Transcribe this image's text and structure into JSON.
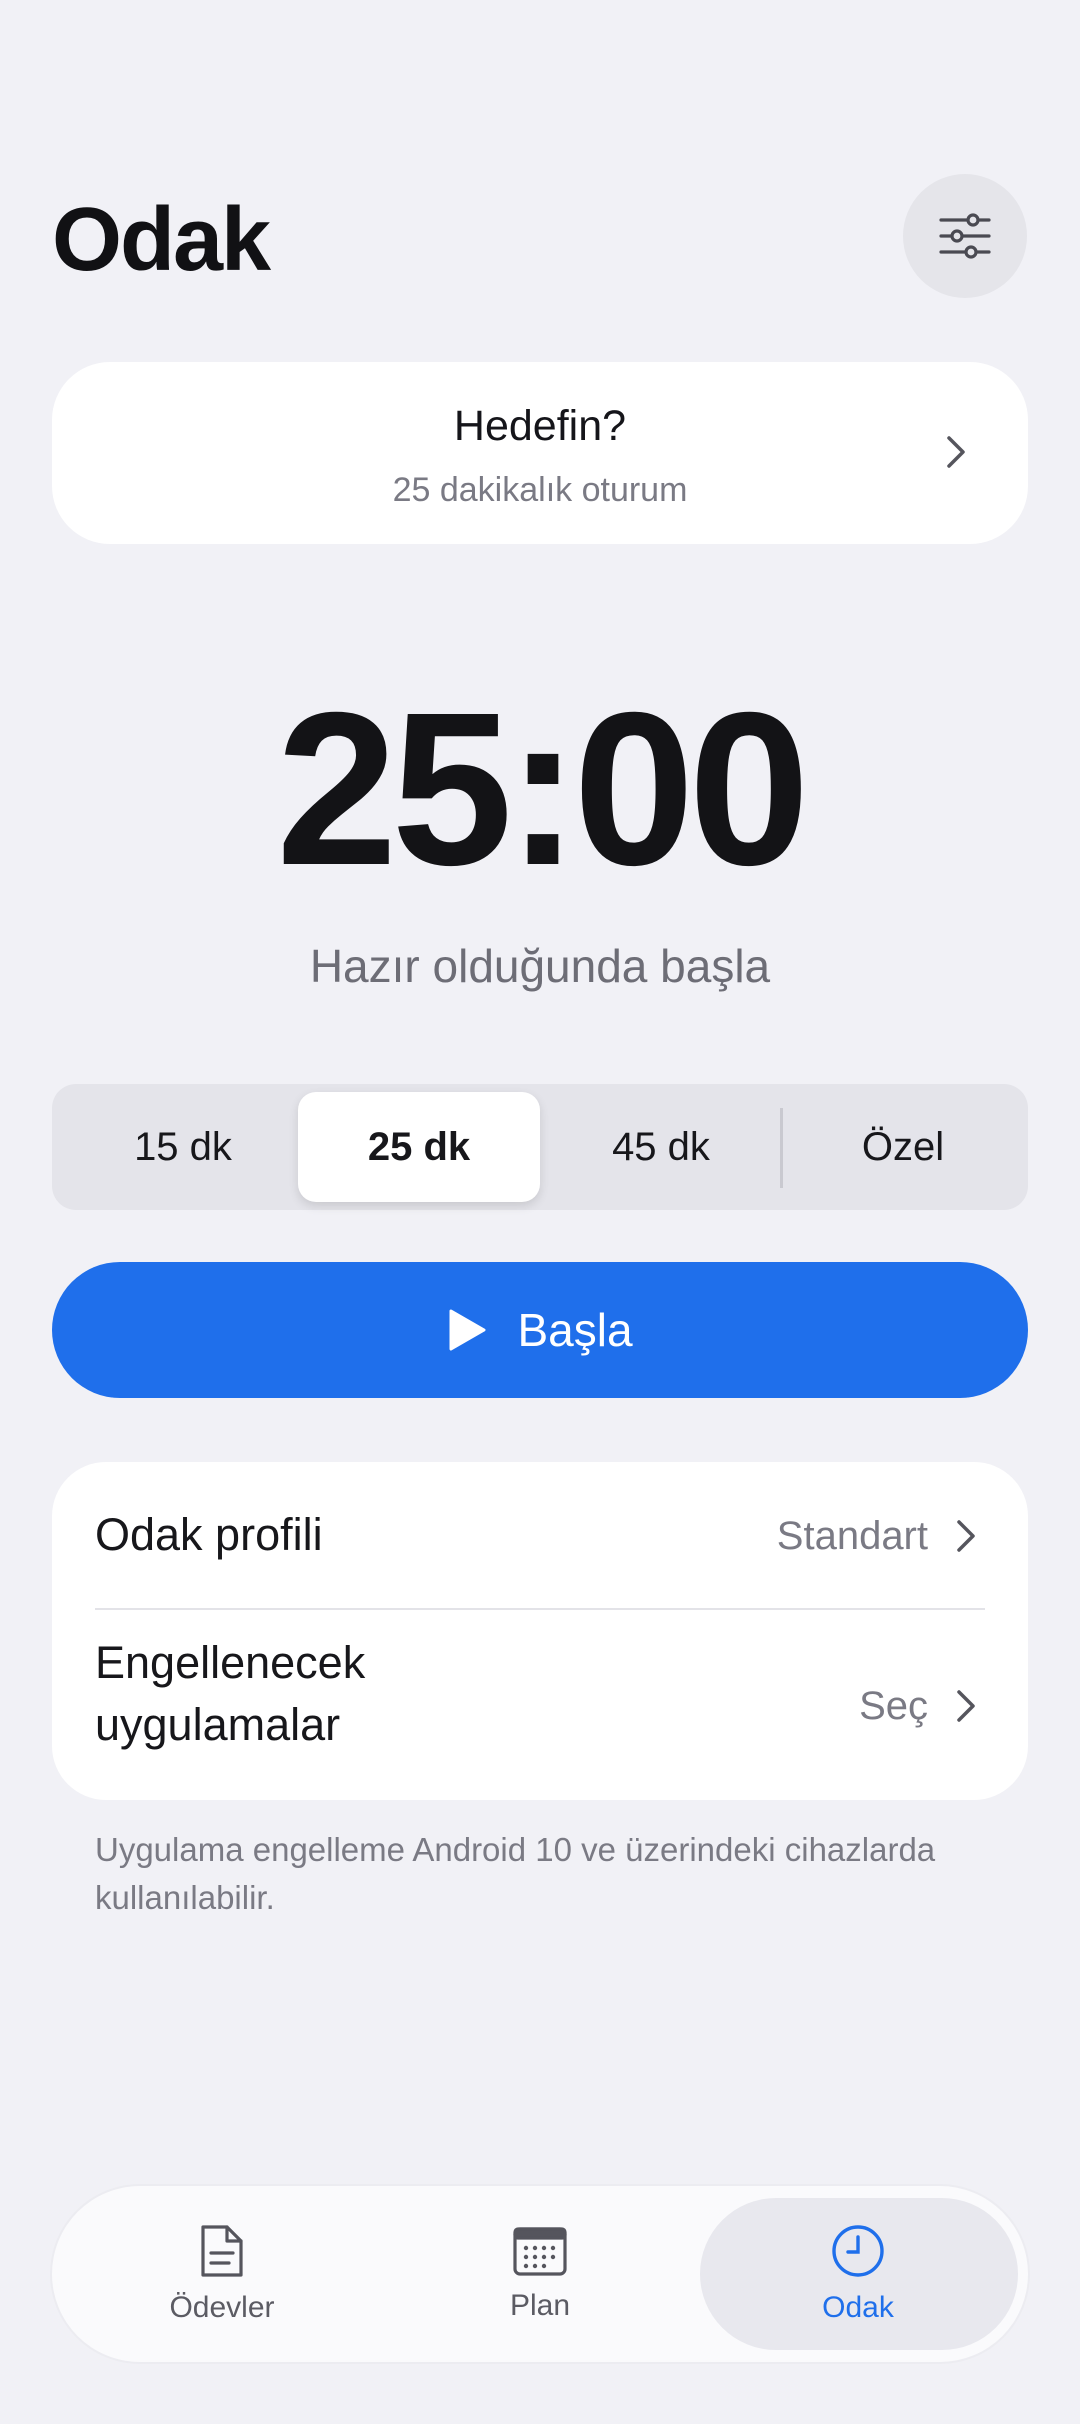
{
  "header": {
    "title": "Odak",
    "settings_icon": "sliders-icon"
  },
  "goal": {
    "title": "Hedefin?",
    "subtitle": "25 dakikalık oturum"
  },
  "timer": {
    "display": "25:00",
    "hint": "Hazır olduğunda başla"
  },
  "durations": {
    "options": [
      "15 dk",
      "25 dk",
      "45 dk",
      "Özel"
    ],
    "selected": "25 dk"
  },
  "start_button": {
    "label": "Başla",
    "icon": "play-icon"
  },
  "settings_list": {
    "profile": {
      "label": "Odak profili",
      "value": "Standart"
    },
    "blocked_apps": {
      "label_line1": "Engellenecek",
      "label_line2": "uygulamalar",
      "value": "Seç"
    }
  },
  "note": "Uygulama engelleme Android 10 ve üzerindeki cihazlarda kullanılabilir.",
  "bottom_nav": {
    "items": [
      {
        "label": "Ödevler",
        "icon": "document-icon"
      },
      {
        "label": "Plan",
        "icon": "calendar-icon"
      },
      {
        "label": "Odak",
        "icon": "clock-icon"
      }
    ],
    "active": "Odak"
  },
  "colors": {
    "accent": "#1f6feb",
    "background": "#f1f1f6",
    "card": "#ffffff",
    "muted": "#7a7a84"
  }
}
